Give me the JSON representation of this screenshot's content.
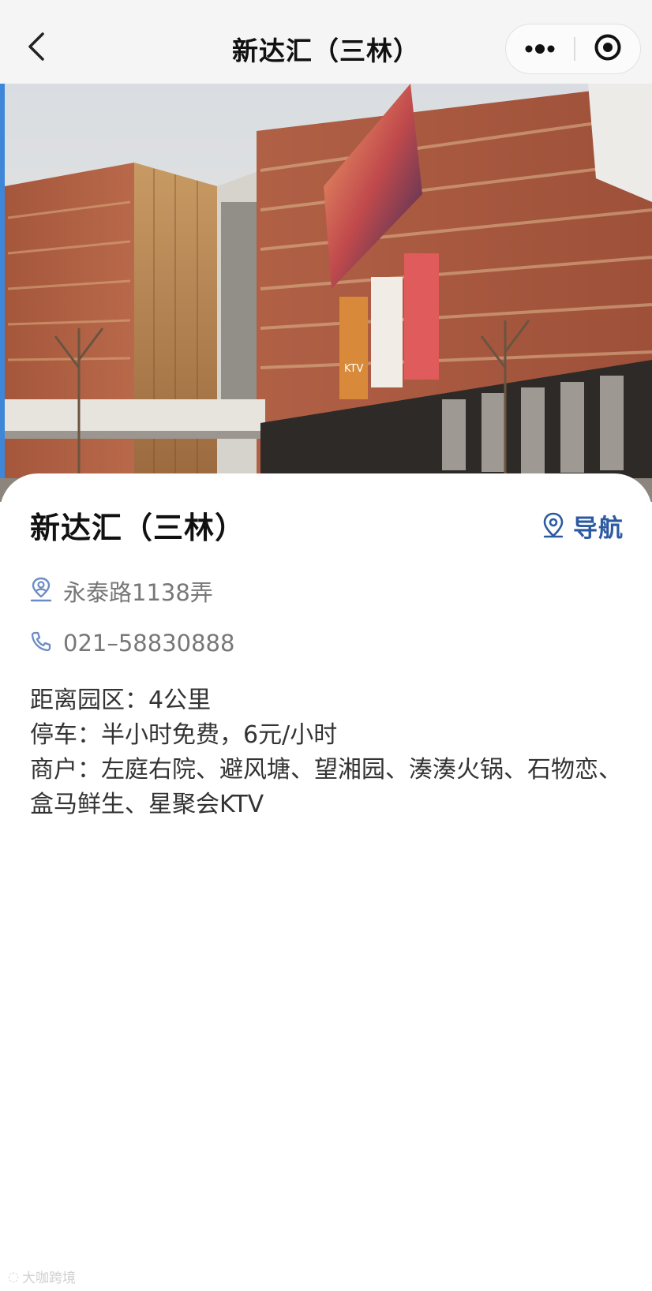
{
  "topbar": {
    "title": "新达汇（三林）",
    "back_icon": "chevron-left-icon",
    "more_icon": "more-dots-icon",
    "close_icon": "target-circle-icon"
  },
  "hero": {
    "description_icon": "mall-photo",
    "sign_text": "KTV"
  },
  "place": {
    "name": "新达汇（三林）",
    "nav_label": "导航",
    "nav_icon": "map-pin-icon",
    "address": "永泰路1138弄",
    "address_icon": "location-person-icon",
    "phone": "021–58830888",
    "phone_icon": "phone-icon",
    "details": [
      "距离园区：4公里",
      "停车：半小时免费，6元/小时",
      "商户：左庭右院、避风塘、望湘园、湊湊火锅、石物恋、盒马鲜生、星聚会KTV"
    ]
  },
  "watermark": {
    "text": "大咖跨境"
  },
  "colors": {
    "accent": "#2c5aa0",
    "icon": "#6b8cc4",
    "topbar_bg": "#f5f5f5",
    "muted_text": "#777777"
  }
}
